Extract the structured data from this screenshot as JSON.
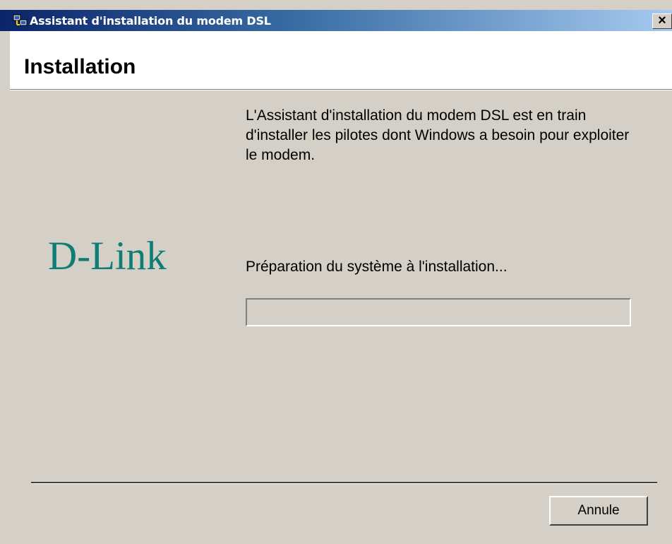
{
  "window": {
    "title": "Assistant d'installation du modem DSL",
    "close_symbol": "×"
  },
  "header": {
    "title": "Installation"
  },
  "branding": {
    "logo_text": "D-Link",
    "logo_color": "#0f7d74"
  },
  "main": {
    "intro": "L'Assistant d'installation du modem DSL est en train d'installer les pilotes dont Windows a besoin pour exploiter le modem.",
    "status": "Préparation du système à l'installation...",
    "progress_percent": 0
  },
  "footer": {
    "cancel_label": "Annule"
  },
  "icons": {
    "title_icon": "network-setup-icon",
    "close_icon": "close-icon"
  },
  "colors": {
    "titlebar_start": "#0a246a",
    "titlebar_end": "#a6caf0",
    "dialog_bg": "#d4d0c8"
  }
}
